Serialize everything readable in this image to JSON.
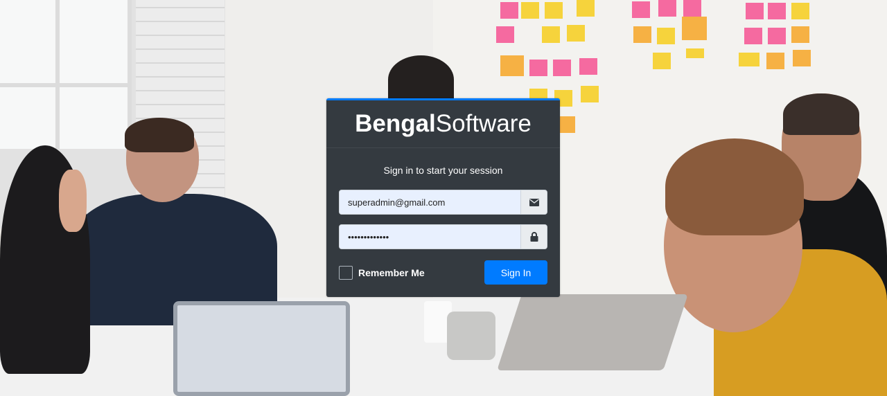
{
  "brand": {
    "bold": "Bengal",
    "light": "Software"
  },
  "login": {
    "message": "Sign in to start your session",
    "email_value": "superadmin@gmail.com",
    "password_value": "•••••••••••••",
    "remember_label": "Remember Me",
    "signin_label": "Sign In",
    "email_icon": "envelope-icon",
    "password_icon": "lock-icon"
  },
  "colors": {
    "card_bg": "#343a40",
    "accent": "#007bff",
    "input_bg": "#e8f0fe"
  }
}
